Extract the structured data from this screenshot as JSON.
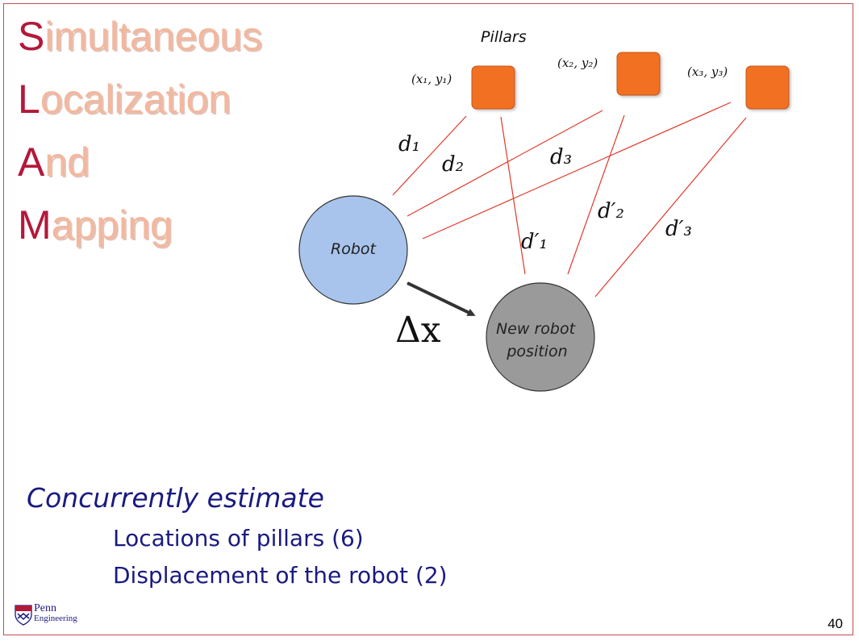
{
  "slide": {
    "title": [
      {
        "initial": "S",
        "rest": "imultaneous"
      },
      {
        "initial": "L",
        "rest": "ocalization"
      },
      {
        "initial": "A",
        "rest": "nd"
      },
      {
        "initial": "M",
        "rest": "apping"
      }
    ],
    "page_number": "40"
  },
  "diagram": {
    "pillars_label": "Pillars",
    "pillars": [
      {
        "coord": "(x₁, y₁)",
        "d": "d₁",
        "d_prime": "d′₁"
      },
      {
        "coord": "(x₂, y₂)",
        "d": "d₂",
        "d_prime": "d′₂"
      },
      {
        "coord": "(x₃, y₃)",
        "d": "d₃",
        "d_prime": "d′₃"
      }
    ],
    "robot_label": "Robot",
    "new_robot_label_line1": "New robot",
    "new_robot_label_line2": "position",
    "delta_label": "Δx",
    "colors": {
      "pillar": "#f26f21",
      "robot": "#a8c4ec",
      "new_robot": "#9a9a9a",
      "distance_line": "#e03a2a",
      "arrow": "#333333"
    }
  },
  "text": {
    "heading": "Concurrently estimate",
    "bullets": [
      "Locations of pillars (6)",
      "Displacement of the robot (2)"
    ]
  },
  "logo": {
    "line1": "Penn",
    "line2": "Engineering"
  }
}
